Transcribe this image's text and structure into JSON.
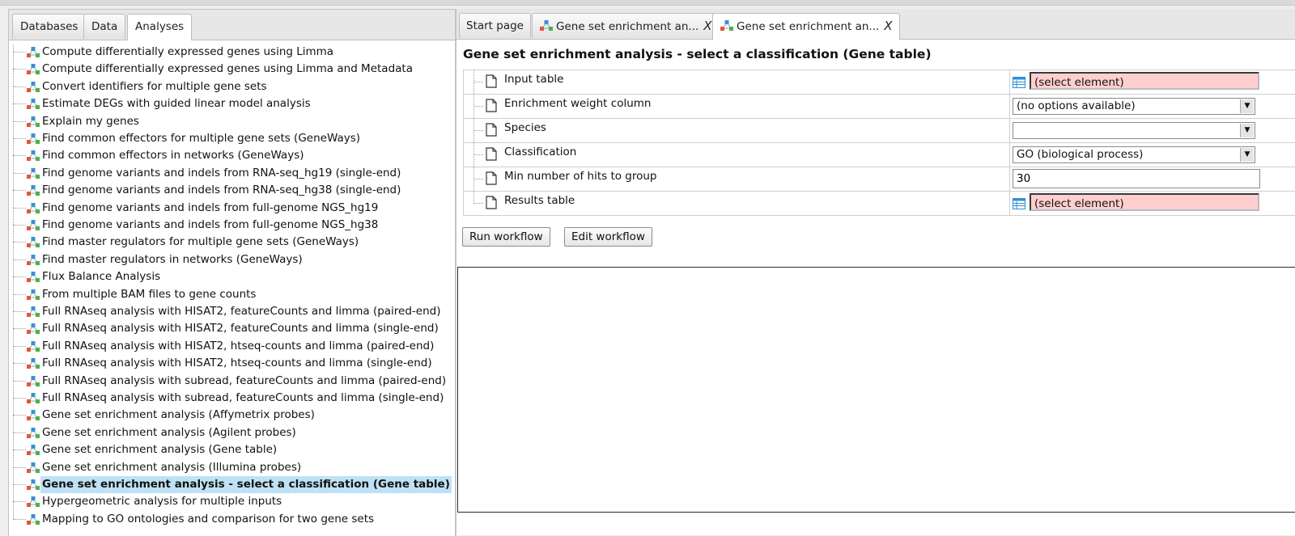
{
  "left_tabs": [
    "Databases",
    "Data",
    "Analyses"
  ],
  "tree_items": [
    "Compute differentially expressed genes using Limma",
    "Compute differentially expressed genes using Limma and Metadata",
    "Convert identifiers for multiple gene sets",
    "Estimate DEGs with guided linear model analysis",
    "Explain my genes",
    "Find common effectors for multiple gene sets (GeneWays)",
    "Find common effectors in networks (GeneWays)",
    "Find genome variants and indels from RNA-seq_hg19 (single-end)",
    "Find genome variants and indels from RNA-seq_hg38 (single-end)",
    "Find genome variants and indels from full-genome NGS_hg19",
    "Find genome variants and indels from full-genome NGS_hg38",
    "Find master regulators for multiple gene sets (GeneWays)",
    "Find master regulators in networks (GeneWays)",
    "Flux Balance Analysis",
    "From multiple BAM files to gene counts",
    "Full RNAseq analysis with HISAT2, featureCounts and limma (paired-end)",
    "Full RNAseq analysis with HISAT2, featureCounts and limma (single-end)",
    "Full RNAseq analysis with HISAT2, htseq-counts and limma (paired-end)",
    "Full RNAseq analysis with HISAT2, htseq-counts and limma (single-end)",
    "Full RNAseq analysis with subread, featureCounts and limma (paired-end)",
    "Full RNAseq analysis with subread, featureCounts and limma (single-end)",
    "Gene set enrichment analysis (Affymetrix probes)",
    "Gene set enrichment analysis (Agilent probes)",
    "Gene set enrichment analysis (Gene table)",
    "Gene set enrichment analysis (Illumina probes)",
    "Gene set enrichment analysis - select a classification (Gene table)",
    "Hypergeometric analysis for multiple inputs",
    "Mapping to GO ontologies and comparison for two gene sets"
  ],
  "selected_tree_item": "Gene set enrichment analysis - select a classification (Gene table)",
  "right_tabs": [
    {
      "label": "Start page",
      "closable": false,
      "icon": false
    },
    {
      "label": "Gene set enrichment an...",
      "closable": true,
      "icon": true
    },
    {
      "label": "Gene set enrichment an...",
      "closable": true,
      "icon": true
    }
  ],
  "close_glyph": "X",
  "page_title": "Gene set enrichment analysis - select a classification (Gene table)",
  "params": [
    {
      "name": "Input table",
      "type": "element",
      "value": "(select element)"
    },
    {
      "name": "Enrichment weight column",
      "type": "select",
      "value": "(no options available)"
    },
    {
      "name": "Species",
      "type": "select",
      "value": ""
    },
    {
      "name": "Classification",
      "type": "select",
      "value": "GO (biological process)"
    },
    {
      "name": "Min number of hits to group",
      "type": "text",
      "value": "30"
    },
    {
      "name": "Results table",
      "type": "element",
      "value": "(select element)"
    }
  ],
  "buttons": {
    "run": "Run workflow",
    "edit": "Edit workflow"
  },
  "colors": {
    "selected_row": "#bfe1f5",
    "required_field": "#ffcfcf"
  }
}
